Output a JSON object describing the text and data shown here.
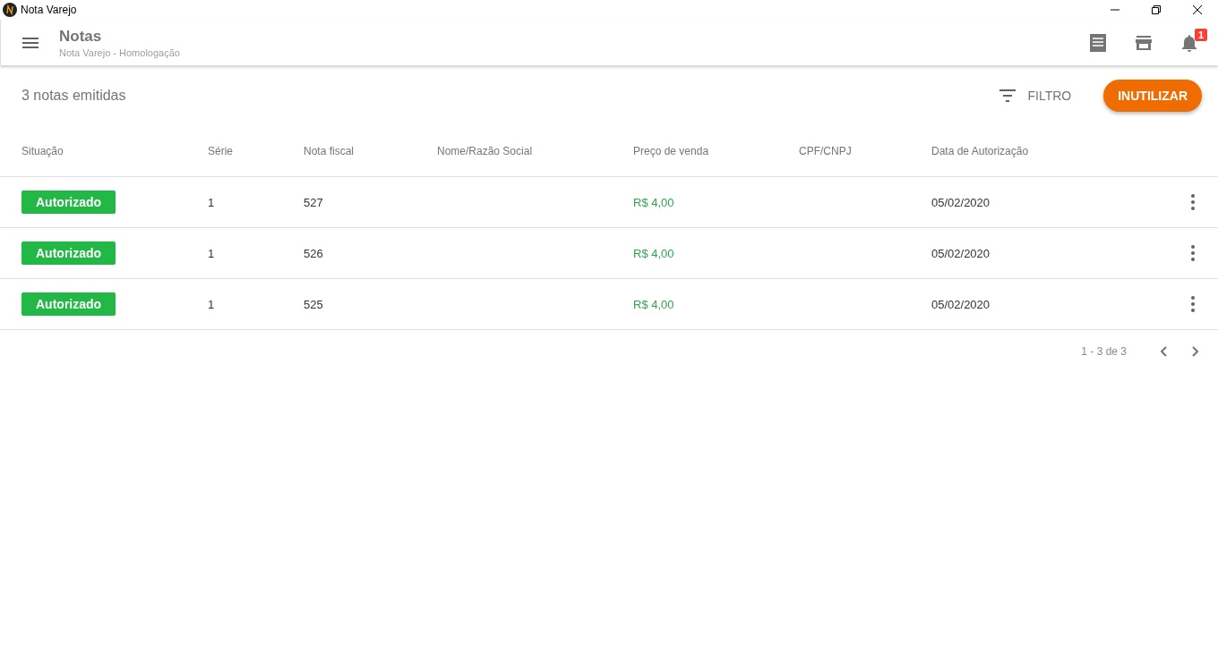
{
  "window": {
    "title": "Nota Varejo"
  },
  "app_bar": {
    "title": "Notas",
    "subtitle": "Nota Varejo - Homologação",
    "notification_count": "1"
  },
  "toolbar": {
    "summary": "3 notas emitidas",
    "filter_label": "FILTRO",
    "action_label": "INUTILIZAR"
  },
  "table": {
    "columns": [
      "Situação",
      "Série",
      "Nota fiscal",
      "Nome/Razão Social",
      "Preço de venda",
      "CPF/CNPJ",
      "Data de Autorização"
    ],
    "rows": [
      {
        "status": {
          "label": "Autorizado",
          "kind": "authorized"
        },
        "serie": "1",
        "nota": "527",
        "nome": "",
        "preco": "R$ 4,00",
        "cpf": "",
        "data": "05/02/2020"
      },
      {
        "status": {
          "label": "Autorizado",
          "kind": "authorized"
        },
        "serie": "1",
        "nota": "526",
        "nome": "",
        "preco": "R$ 4,00",
        "cpf": "",
        "data": "05/02/2020"
      },
      {
        "status": {
          "label": "Autorizado",
          "kind": "authorized"
        },
        "serie": "1",
        "nota": "525",
        "nome": "",
        "preco": "R$ 4,00",
        "cpf": "",
        "data": "05/02/2020"
      }
    ]
  },
  "pagination": {
    "range": "1 - 3 de 3"
  }
}
